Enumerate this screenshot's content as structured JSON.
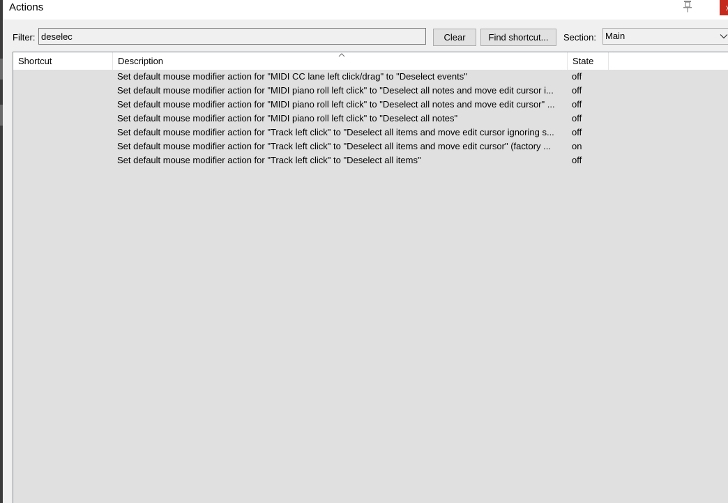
{
  "window": {
    "title": "Actions",
    "close_label": "x"
  },
  "toolbar": {
    "filter_label": "Filter:",
    "filter_value": "deselec",
    "clear_label": "Clear",
    "find_shortcut_label": "Find shortcut...",
    "section_label": "Section:",
    "section_value": "Main"
  },
  "table": {
    "columns": [
      "Shortcut",
      "Description",
      "State"
    ],
    "rows": [
      {
        "shortcut": "",
        "description": "Set default mouse modifier action for \"MIDI CC lane left click/drag\" to \"Deselect events\"",
        "state": "off"
      },
      {
        "shortcut": "",
        "description": "Set default mouse modifier action for \"MIDI piano roll left click\" to \"Deselect all notes and move edit cursor i...",
        "state": "off"
      },
      {
        "shortcut": "",
        "description": "Set default mouse modifier action for \"MIDI piano roll left click\" to \"Deselect all notes and move edit cursor\" ...",
        "state": "off"
      },
      {
        "shortcut": "",
        "description": "Set default mouse modifier action for \"MIDI piano roll left click\" to \"Deselect all notes\"",
        "state": "off"
      },
      {
        "shortcut": "",
        "description": "Set default mouse modifier action for \"Track left click\" to \"Deselect all items and move edit cursor ignoring s...",
        "state": "off"
      },
      {
        "shortcut": "",
        "description": "Set default mouse modifier action for \"Track left click\" to \"Deselect all items and move edit cursor\" (factory ...",
        "state": "on"
      },
      {
        "shortcut": "",
        "description": "Set default mouse modifier action for \"Track left click\" to \"Deselect all items\"",
        "state": "off"
      }
    ]
  },
  "icons": {
    "pin": "pin-icon",
    "sort": "sort-arrow-icon",
    "dropdown": "chevron-down-icon"
  },
  "colors": {
    "close_bg": "#c42b1c",
    "list_bg": "#e0e0e0",
    "window_bg": "#f0f0f0"
  }
}
